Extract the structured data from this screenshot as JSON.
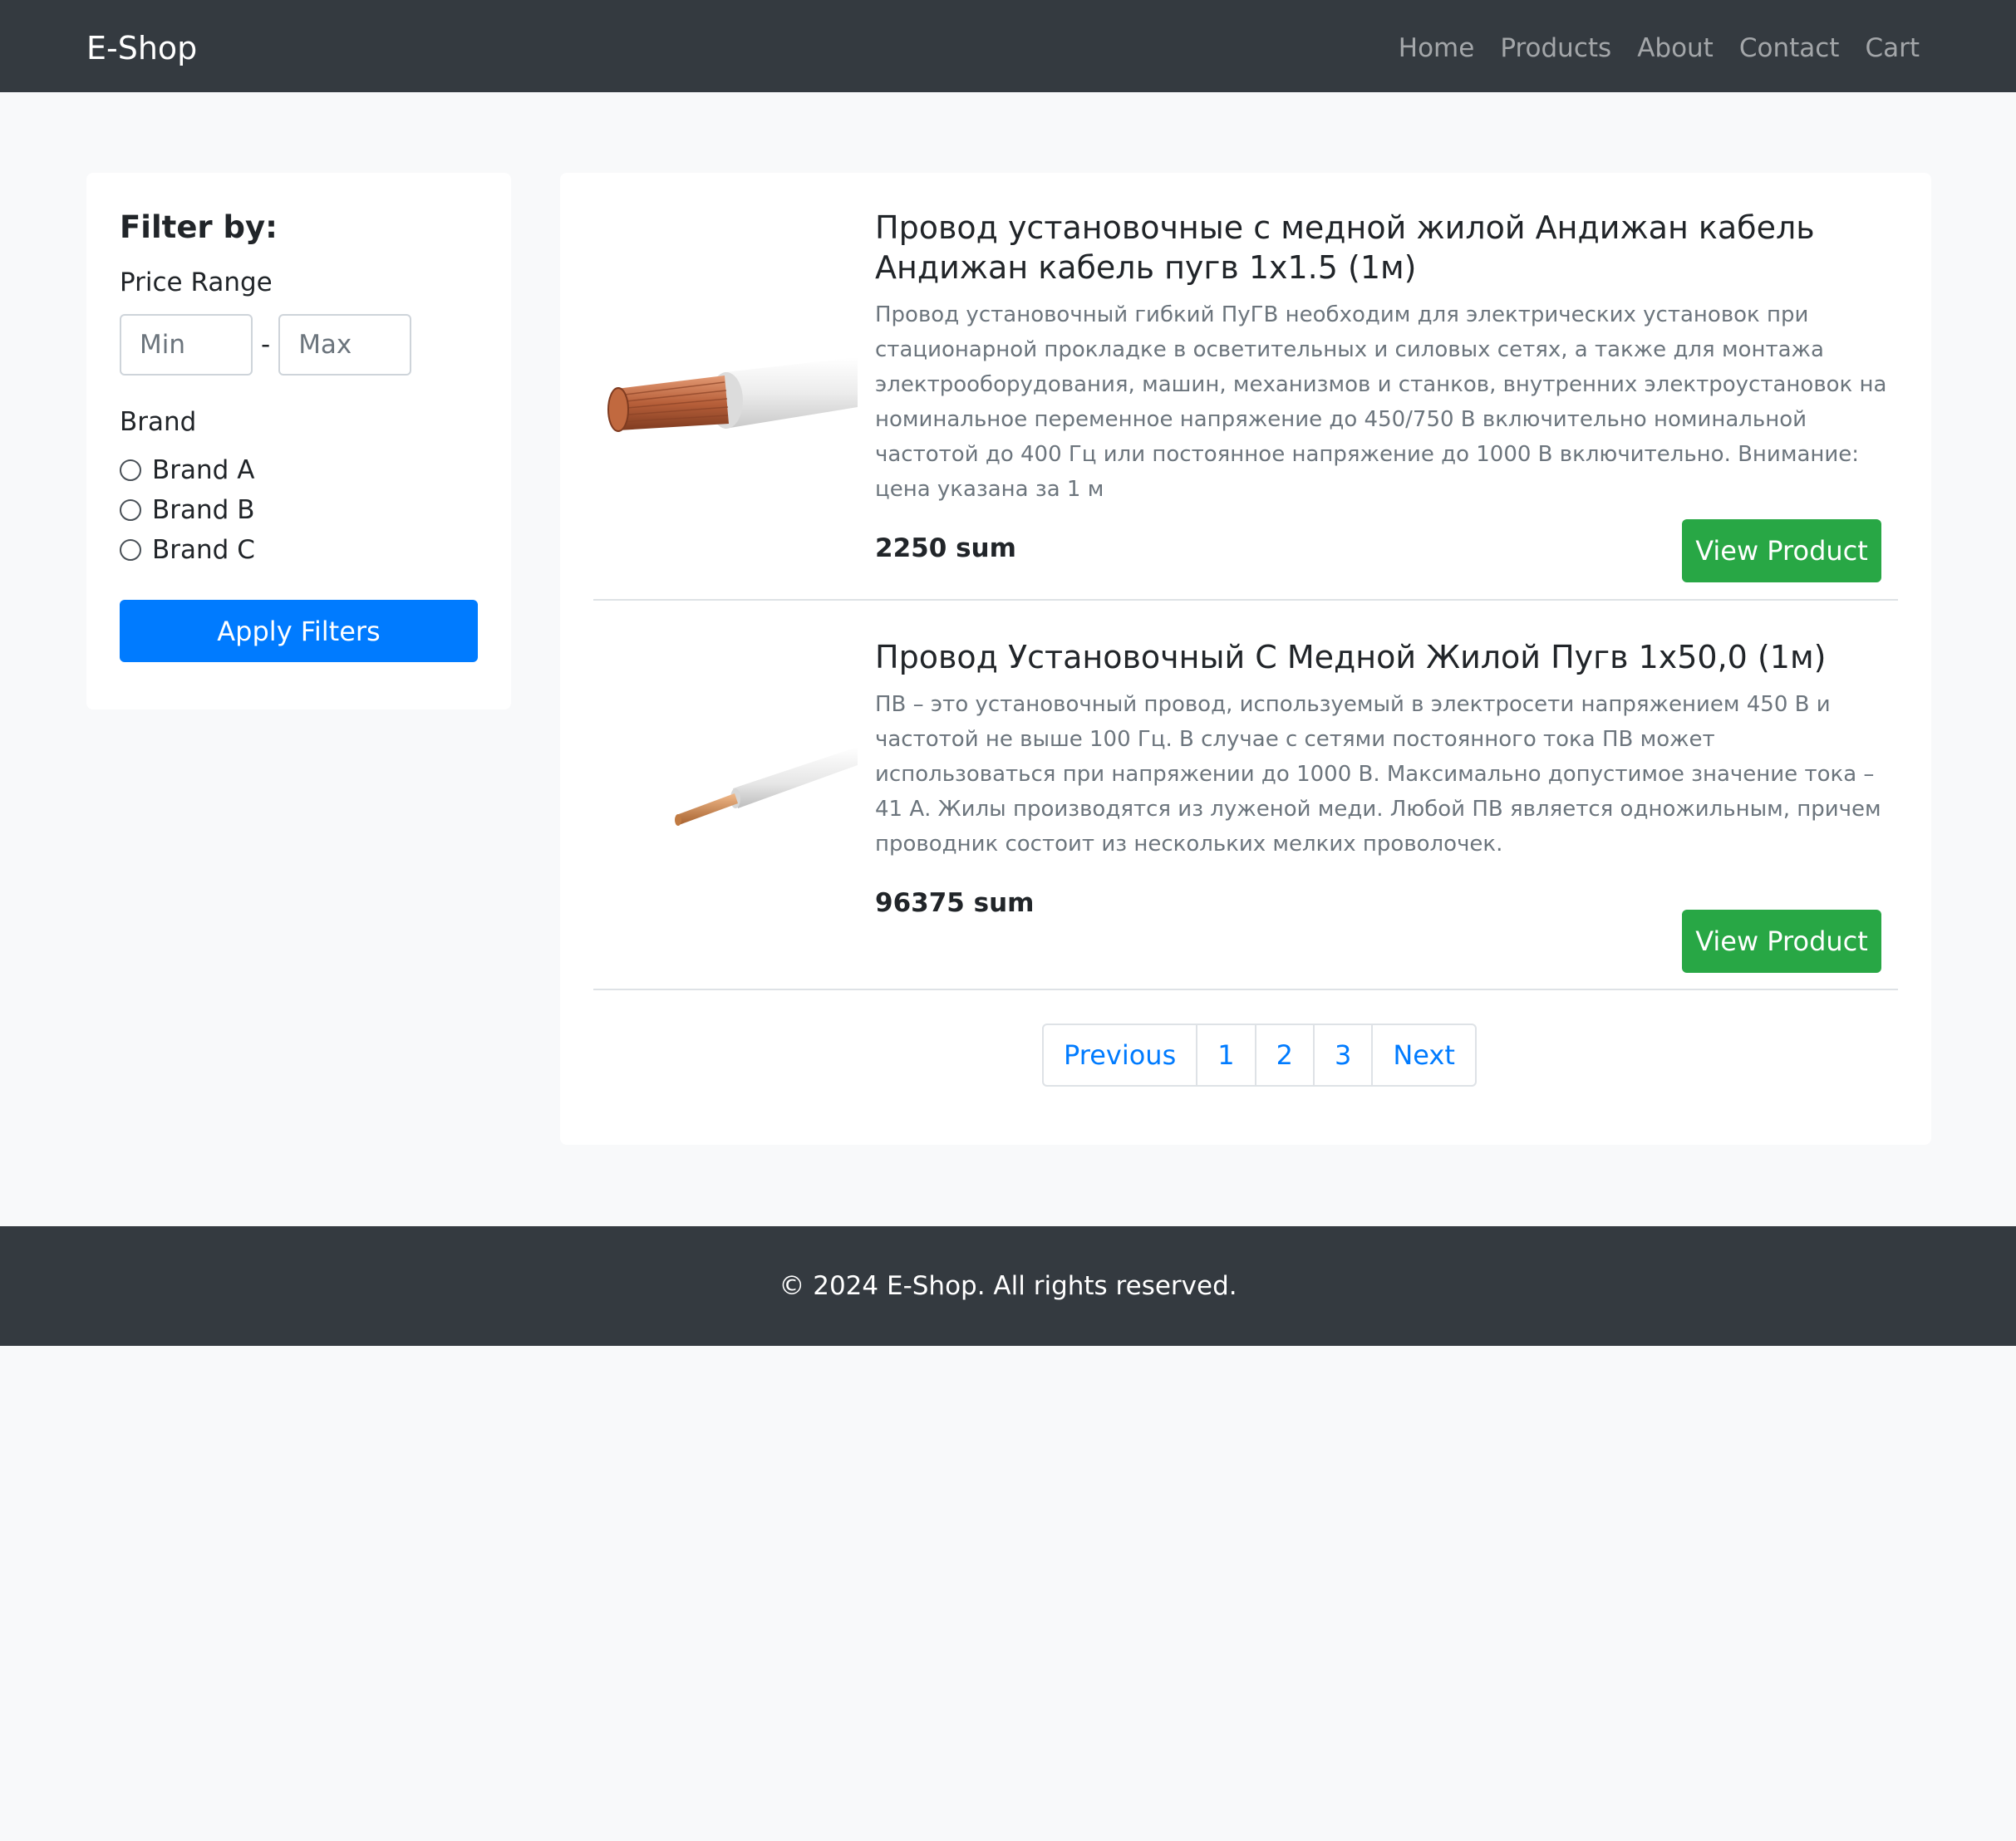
{
  "navbar": {
    "brand": "E-Shop",
    "links": [
      "Home",
      "Products",
      "About",
      "Contact",
      "Cart"
    ]
  },
  "filters": {
    "title": "Filter by:",
    "price_range_label": "Price Range",
    "min_placeholder": "Min",
    "max_placeholder": "Max",
    "separator": "-",
    "brand_label": "Brand",
    "brands": [
      "Brand A",
      "Brand B",
      "Brand C"
    ],
    "apply_label": "Apply Filters"
  },
  "products": [
    {
      "title": "Провод установочные с медной жилой Андижан кабель Андижан кабель пугв 1х1.5 (1м)",
      "description": "Провод установочный гибкий ПуГВ необходим для электрических установок при стационарной прокладке в осветительных и силовых сетях, а также для монтажа электрооборудования, машин, механизмов и станков, внутренних электроустановок на номинальное переменное напряжение до 450/750 В включительно номинальной частотой до 400 Гц или постоянное напряжение до 1000 В включительно. Внимание: цена указана за 1 м",
      "price": "2250 sum",
      "button": "View Product"
    },
    {
      "title": "Провод Установочный С Медной Жилой Пугв 1х50,0 (1м)",
      "description": "ПВ – это установочный провод, используемый в электросети напряжением 450 В и частотой не выше 100 Гц. В случае с сетями постоянного тока ПВ может использоваться при напряжении до 1000 В. Максимально допустимое значение тока – 41 А. Жилы производятся из луженой меди. Любой ПВ является одножильным, причем проводник состоит из нескольких мелких проволочек.",
      "price": "96375 sum",
      "button": "View Product"
    }
  ],
  "pagination": [
    "Previous",
    "1",
    "2",
    "3",
    "Next"
  ],
  "footer": {
    "text": "© 2024 E-Shop. All rights reserved."
  },
  "colors": {
    "navbar_bg": "#343a40",
    "primary": "#007bff",
    "success": "#28a745",
    "page_bg": "#f8f9fa"
  }
}
